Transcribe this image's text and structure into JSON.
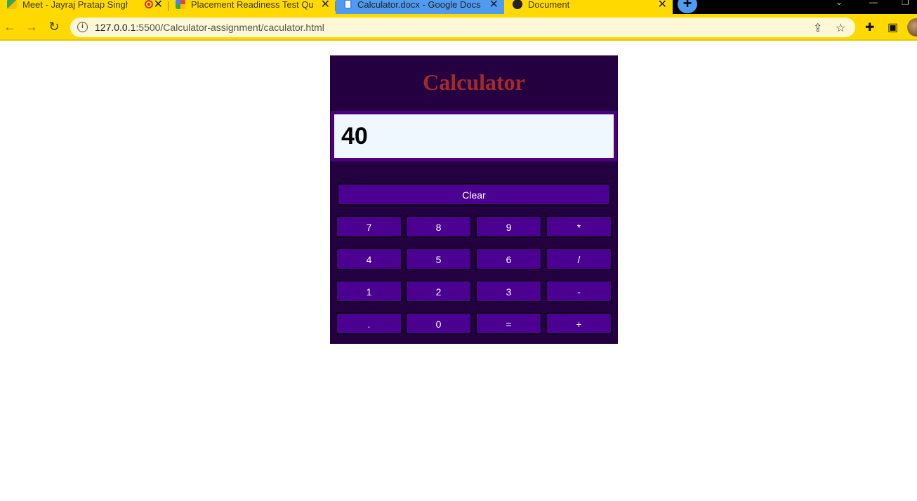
{
  "browser": {
    "tabs": [
      {
        "title": "Meet - Jayraj Pratap Singh| P",
        "favicon": "meet-icon"
      },
      {
        "title": "Placement Readiness Test Questi",
        "favicon": "colorful-logo-icon"
      },
      {
        "title": "Calculator.docx - Google Docs",
        "favicon": "docs-icon"
      },
      {
        "title": "Document",
        "favicon": "globe-icon"
      }
    ],
    "url_host": "127.0.0.1",
    "url_path": ":5500/Calculator-assignment/caculator.html"
  },
  "calculator": {
    "title": "Calculator",
    "display_value": "40",
    "clear_label": "Clear",
    "keys": [
      [
        "7",
        "8",
        "9",
        "*"
      ],
      [
        "4",
        "5",
        "6",
        "/"
      ],
      [
        "1",
        "2",
        "3",
        "-"
      ],
      [
        ".",
        "0",
        "=",
        "+"
      ]
    ]
  },
  "colors": {
    "accent": "#ffd900",
    "calc_bg": "#250040",
    "button_bg": "#4b0091",
    "title_color": "#a32a2a",
    "display_bg": "#f0f8ff"
  }
}
